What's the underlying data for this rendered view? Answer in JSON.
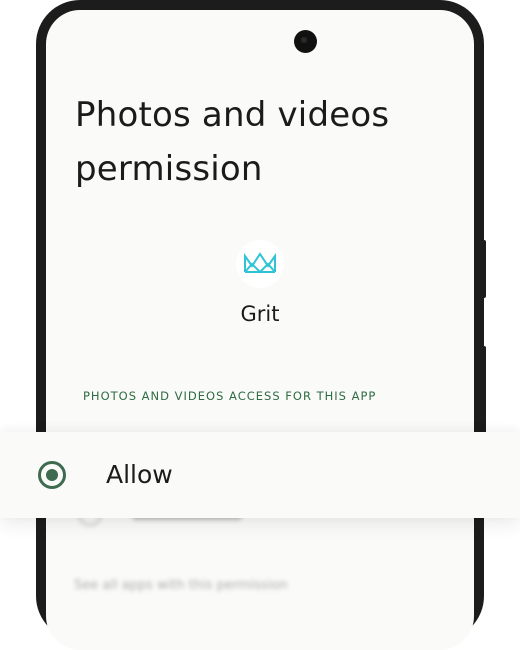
{
  "screen": {
    "title": "Photos and videos permission",
    "app": {
      "name": "Grit",
      "icon": "crown-logo-icon"
    },
    "section_header": "PHOTOS AND VIDEOS ACCESS FOR THIS APP",
    "options": [
      {
        "label": "Allow",
        "selected": true
      },
      {
        "label": "Don't allow",
        "selected": false
      }
    ],
    "footer_link": "See all apps with this permission"
  },
  "colors": {
    "accent": "#3e6b4f",
    "section_header": "#2f6b43",
    "logo": "#2ec4d6",
    "background": "#fafaf8"
  }
}
